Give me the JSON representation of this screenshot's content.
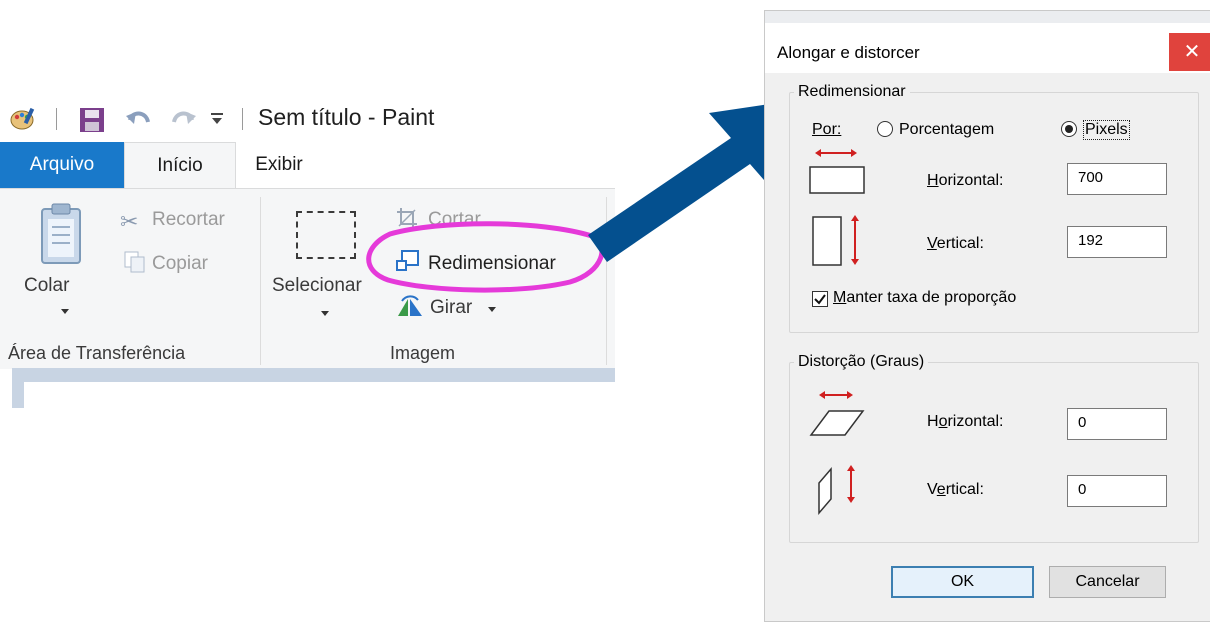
{
  "paint": {
    "window_title": "Sem título - Paint",
    "tabs": {
      "file": "Arquivo",
      "home": "Início",
      "view": "Exibir"
    },
    "ribbon": {
      "clipboard": {
        "paste_label": "Colar",
        "cut_label": "Recortar",
        "copy_label": "Copiar",
        "group_label": "Área de Transferência"
      },
      "image": {
        "select_label": "Selecionar",
        "crop_label": "Cortar",
        "resize_label": "Redimensionar",
        "rotate_label": "Girar",
        "group_label": "Imagem"
      }
    }
  },
  "annotation": {
    "highlight_color": "#e53ad9",
    "arrow_color": "#04508f"
  },
  "dialog": {
    "title": "Alongar e distorcer",
    "resize": {
      "group_label": "Redimensionar",
      "by_label": "Por:",
      "option_percent": "Porcentagem",
      "option_pixels": "Pixels",
      "selected_option": "Pixels",
      "horizontal_label": "Horizontal:",
      "horizontal_value": "700",
      "vertical_label": "Vertical:",
      "vertical_value": "192",
      "keep_ratio_label": "Manter taxa de proporção",
      "keep_ratio_checked": true
    },
    "skew": {
      "group_label": "Distorção (Graus)",
      "horizontal_label": "Horizontal:",
      "horizontal_value": "0",
      "vertical_label": "Vertical:",
      "vertical_value": "0"
    },
    "ok_label": "OK",
    "cancel_label": "Cancelar",
    "close_glyph": "✕"
  }
}
